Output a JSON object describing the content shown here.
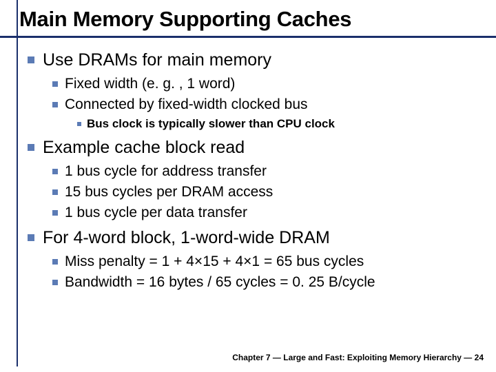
{
  "title": "Main Memory Supporting Caches",
  "bullets": {
    "b1": {
      "text": "Use DRAMs for main memory",
      "sub": {
        "s1": "Fixed width (e. g. , 1 word)",
        "s2": "Connected by fixed-width clocked bus",
        "s2sub": {
          "t1": "Bus clock is typically slower than CPU clock"
        }
      }
    },
    "b2": {
      "text": "Example cache block read",
      "sub": {
        "s1": "1 bus cycle for address transfer",
        "s2": "15 bus cycles per DRAM access",
        "s3": "1 bus cycle per data transfer"
      }
    },
    "b3": {
      "text": "For 4-word block, 1-word-wide DRAM",
      "sub": {
        "s1": "Miss penalty = 1 + 4×15 + 4×1 = 65 bus cycles",
        "s2": "Bandwidth = 16 bytes / 65 cycles = 0. 25 B/cycle"
      }
    }
  },
  "footer": "Chapter 7 — Large and Fast: Exploiting Memory Hierarchy — 24"
}
